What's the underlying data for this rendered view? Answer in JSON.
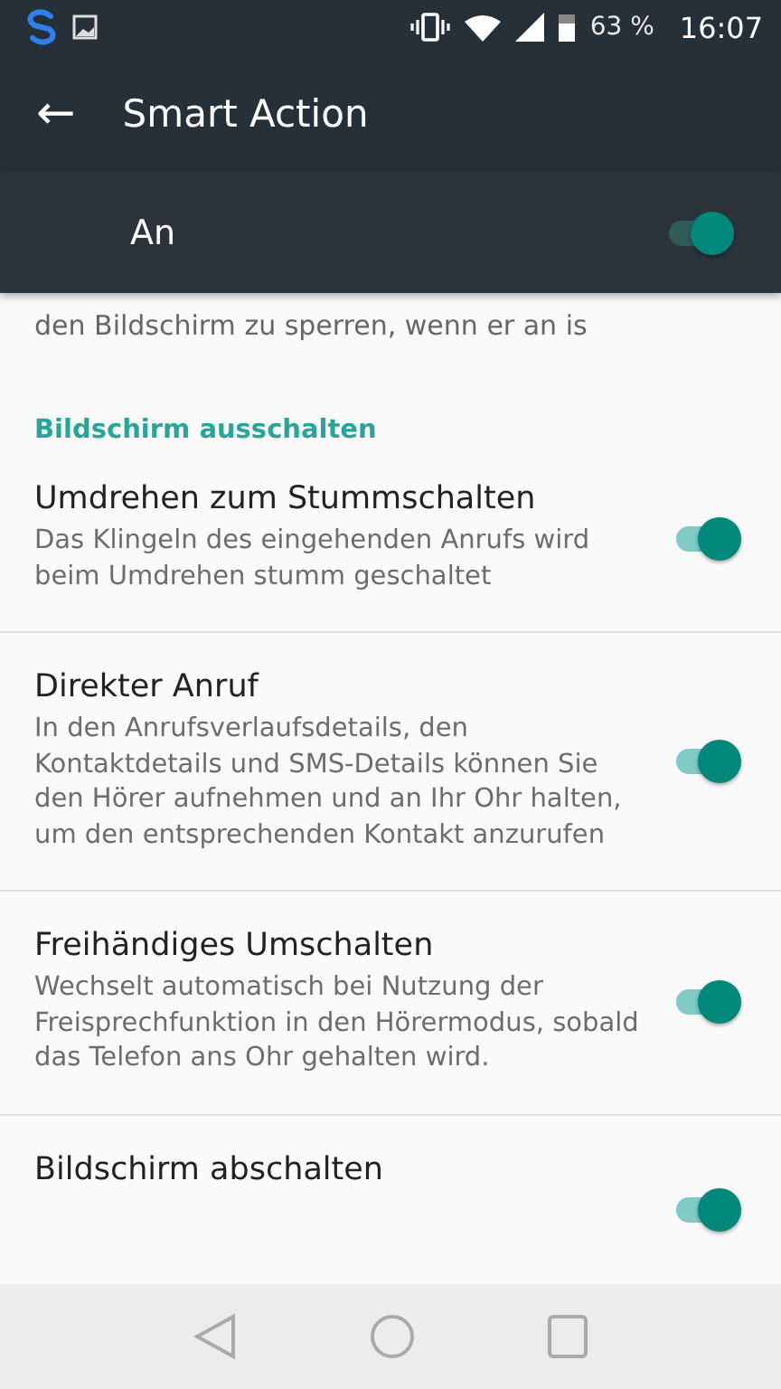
{
  "status_bar": {
    "battery": "63 %",
    "time": "16:07"
  },
  "app_bar": {
    "back": "←",
    "title": "Smart Action"
  },
  "master_switch": {
    "label": "An",
    "on": true
  },
  "partial_text": "den Bildschirm zu sperren, wenn er an is",
  "section_header": "Bildschirm ausschalten",
  "settings": [
    {
      "title": "Umdrehen zum Stummschalten",
      "description": "Das Klingeln des eingehenden Anrufs wird beim Umdrehen stumm geschaltet",
      "on": true
    },
    {
      "title": "Direkter Anruf",
      "description": "In den Anrufsverlaufsdetails, den Kontaktdetails und SMS-Details können Sie den Hörer aufnehmen und an Ihr Ohr halten, um den entsprechenden Kontakt anzurufen",
      "on": true
    },
    {
      "title": "Freihändiges Umschalten",
      "description": "Wechselt automatisch bei Nutzung der Freisprechfunktion in den Hörermodus, sobald das Telefon ans Ohr gehalten wird.",
      "on": true
    },
    {
      "title": "Bildschirm abschalten",
      "on": true
    }
  ]
}
